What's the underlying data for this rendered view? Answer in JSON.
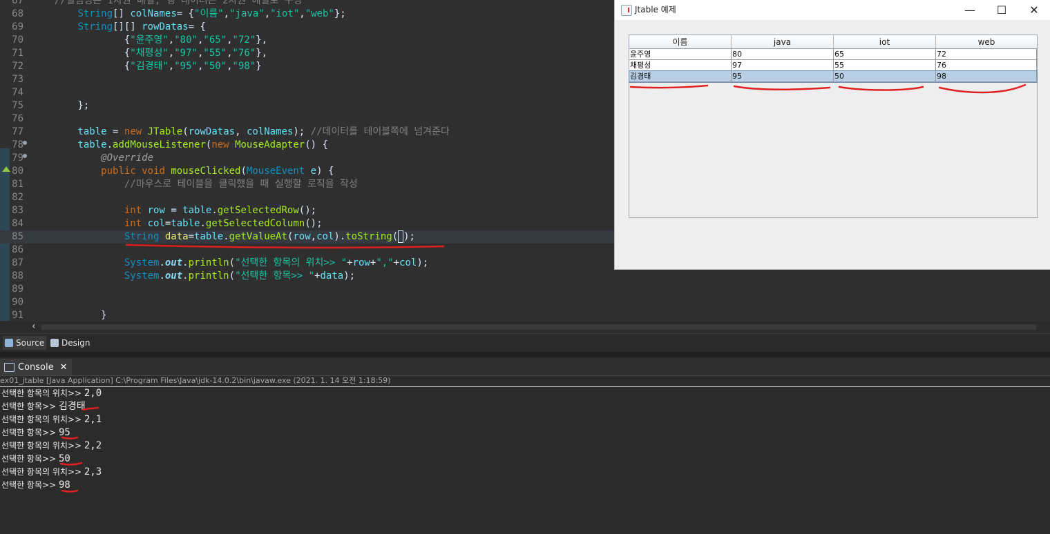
{
  "editor": {
    "lines": [
      {
        "num": "67",
        "html": "    <span class=\"c\">//컬럼명은 1차원 배열, 행 데이터는 2차원 배열로 구성</span>"
      },
      {
        "num": "68",
        "html": "        <span class=\"t\">String</span>[] <span class=\"v\">colNames</span>= {<span class=\"s\">\"이름\"</span>,<span class=\"s\">\"java\"</span>,<span class=\"s\">\"iot\"</span>,<span class=\"s\">\"web\"</span>};"
      },
      {
        "num": "69",
        "html": "        <span class=\"t\">String</span>[][] <span class=\"v\">rowDatas</span>= {"
      },
      {
        "num": "70",
        "html": "                {<span class=\"s\">\"윤주영\"</span>,<span class=\"s\">\"80\"</span>,<span class=\"s\">\"65\"</span>,<span class=\"s\">\"72\"</span>},"
      },
      {
        "num": "71",
        "html": "                {<span class=\"s\">\"채평성\"</span>,<span class=\"s\">\"97\"</span>,<span class=\"s\">\"55\"</span>,<span class=\"s\">\"76\"</span>},"
      },
      {
        "num": "72",
        "html": "                {<span class=\"s\">\"김경태\"</span>,<span class=\"s\">\"95\"</span>,<span class=\"s\">\"50\"</span>,<span class=\"s\">\"98\"</span>}"
      },
      {
        "num": "73",
        "html": ""
      },
      {
        "num": "74",
        "html": ""
      },
      {
        "num": "75",
        "html": "        };"
      },
      {
        "num": "76",
        "html": ""
      },
      {
        "num": "77",
        "html": "        <span class=\"v\">table</span> = <span class=\"k\">new</span> <span class=\"m\">JTable</span>(<span class=\"v\">rowDatas</span>, <span class=\"v\">colNames</span>); <span class=\"c\">//데이터를 테이블쪽에 넘겨준다</span>"
      },
      {
        "num": "78",
        "html": "        <span class=\"v\">table</span>.<span class=\"m\">addMouseListener</span>(<span class=\"k\">new</span> <span class=\"m\">MouseAdapter</span>() {"
      },
      {
        "num": "79",
        "html": "            <span class=\"a\">@Override</span>"
      },
      {
        "num": "80",
        "html": "            <span class=\"k\">public</span> <span class=\"k\">void</span> <span class=\"m\">mouseClicked</span>(<span class=\"t\">MouseEvent</span> <span class=\"v\">e</span>) {"
      },
      {
        "num": "81",
        "html": "                <span class=\"c\">//마우스로 테이블을 클릭했을 때 실행할 로직을 작성</span>"
      },
      {
        "num": "82",
        "html": ""
      },
      {
        "num": "83",
        "html": "                <span class=\"k\">int</span> <span class=\"v\">row</span> = <span class=\"v\">table</span>.<span class=\"m\">getSelectedRow</span>();"
      },
      {
        "num": "84",
        "html": "                <span class=\"k\">int</span> <span class=\"v\">col</span>=<span class=\"v\">table</span>.<span class=\"m\">getSelectedColumn</span>();"
      },
      {
        "num": "85",
        "html": "                <span class=\"t\">String</span> <span class=\"v\" style=\"color:#f3ec79\">data</span>=<span class=\"v\">table</span>.<span class=\"m\">getValueAt</span>(<span class=\"v\">row</span>,<span class=\"v\">col</span>).<span class=\"m\">toString</span>(<span class=\"caret\"></span>);"
      },
      {
        "num": "86",
        "html": ""
      },
      {
        "num": "87",
        "html": "                <span class=\"t\">System</span>.<span class=\"f\">out</span>.<span class=\"m\">println</span>(<span class=\"s\">\"선택한 항목의 위치>> \"</span>+<span class=\"v\">row</span>+<span class=\"s\">\",\"</span>+<span class=\"v\">col</span>);"
      },
      {
        "num": "88",
        "html": "                <span class=\"t\">System</span>.<span class=\"f\">out</span>.<span class=\"m\">println</span>(<span class=\"s\">\"선택한 항목>> \"</span>+<span class=\"v\">data</span>);"
      },
      {
        "num": "89",
        "html": ""
      },
      {
        "num": "90",
        "html": ""
      },
      {
        "num": "91",
        "html": "            }"
      }
    ],
    "tabs": {
      "source": "Source",
      "design": "Design"
    }
  },
  "console": {
    "tab_label": "Console",
    "path": "ex01_jtable [Java Application] C:\\Program Files\\Java\\jdk-14.0.2\\bin\\javaw.exe  (2021. 1. 14 오전 1:18:59)",
    "lines": [
      {
        "label": "선택한 항목의 위치>> ",
        "value": "2,0"
      },
      {
        "label": "선택한 항목>> ",
        "value": "김경태"
      },
      {
        "label": "선택한 항목의 위치>> ",
        "value": "2,1"
      },
      {
        "label": "선택한 항목>> ",
        "value": "95"
      },
      {
        "label": "선택한 항목의 위치>> ",
        "value": "2,2"
      },
      {
        "label": "선택한 항목>> ",
        "value": "50"
      },
      {
        "label": "선택한 항목의 위치>> ",
        "value": "2,3"
      },
      {
        "label": "선택한 항목>> ",
        "value": "98"
      }
    ]
  },
  "swing": {
    "title": "Jtable 예제",
    "controls": {
      "minimize": "—",
      "maximize": "☐",
      "close": "✕"
    },
    "table": {
      "columns": [
        "이름",
        "java",
        "iot",
        "web"
      ],
      "rows": [
        [
          "윤주영",
          "80",
          "65",
          "72"
        ],
        [
          "채평성",
          "97",
          "55",
          "76"
        ],
        [
          "김경태",
          "95",
          "50",
          "98"
        ]
      ],
      "selected_row": 2
    }
  },
  "colors": {
    "annotation": "#e01f1f",
    "selection": "#b8cfe5"
  }
}
